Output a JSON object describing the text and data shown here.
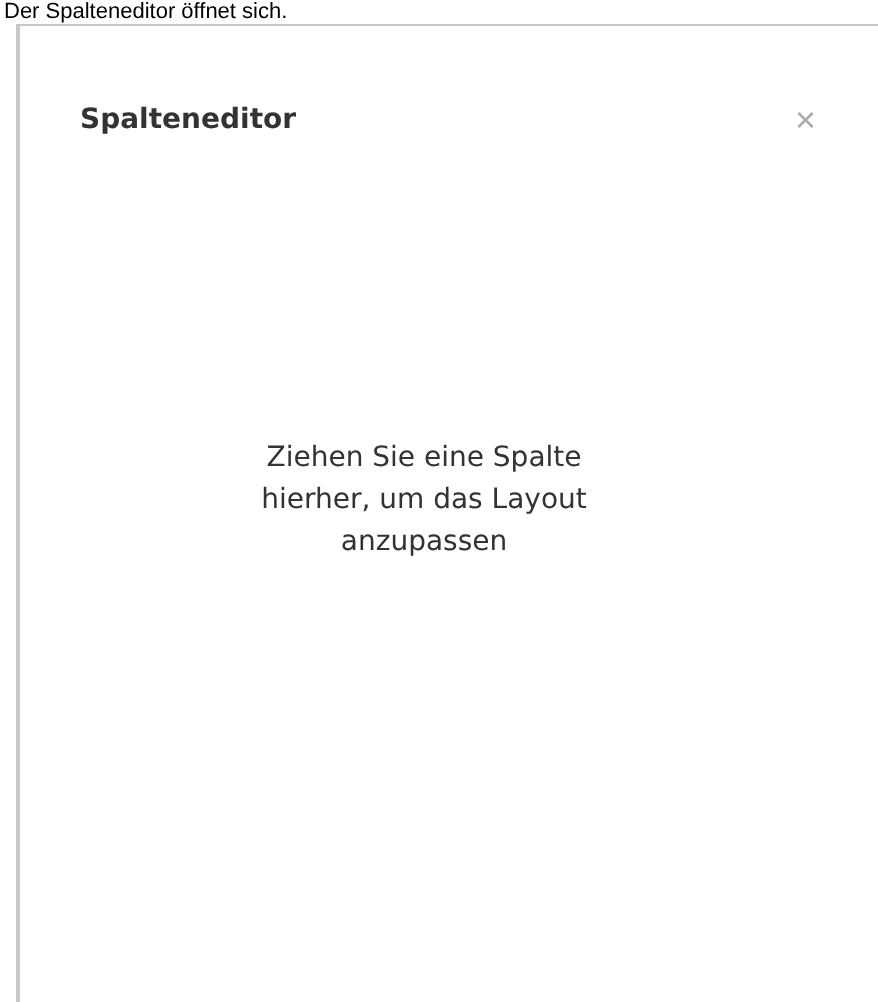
{
  "caption": "Der Spalteneditor öffnet sich.",
  "panel": {
    "title": "Spalteneditor",
    "close": "×",
    "message": "Ziehen Sie eine Spalte hierher, um das Layout anzupassen"
  }
}
